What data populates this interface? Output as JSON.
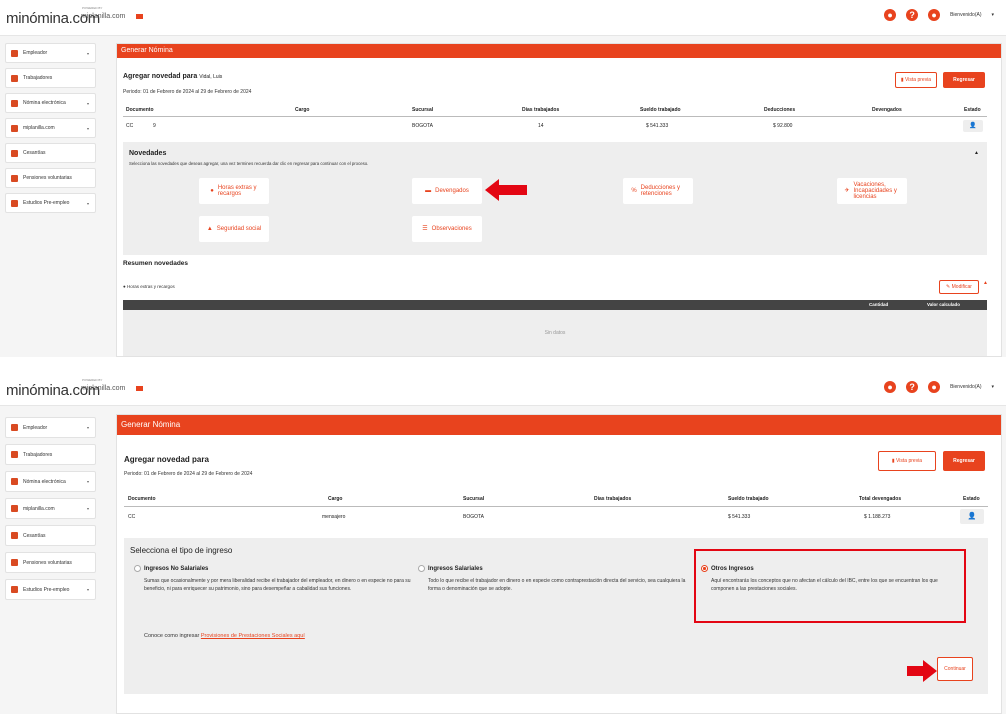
{
  "colors": {
    "brand": "#e8431e",
    "arrow": "#e30613",
    "highlight_box": "#e30613"
  },
  "shot1": {
    "header": {
      "logo": "minómina.com",
      "powered_by": "POWERED BY",
      "sublogo": "miplanilla.com",
      "welcome": "Bienvenido(A)"
    },
    "sidebar": {
      "items": [
        {
          "label": "Empleador",
          "caret": "▾",
          "icon": "building-icon"
        },
        {
          "label": "Trabajadores",
          "caret": "",
          "icon": "users-icon"
        },
        {
          "label": "Nómina electrónica",
          "caret": "▾",
          "icon": "document-icon"
        },
        {
          "label": "miplanilla.com",
          "caret": "▾",
          "icon": "document-icon"
        },
        {
          "label": "Cesantías",
          "caret": "",
          "icon": "piggy-bank-icon"
        },
        {
          "label": "Pensiones voluntarias",
          "caret": "",
          "icon": "hourglass-icon"
        },
        {
          "label": "Estudios Pre-empleo",
          "caret": "▾",
          "icon": "user-dollar-icon"
        }
      ]
    },
    "main": {
      "title": "Generar Nómina",
      "subtitle": "Agregar novedad para",
      "employee": "Vidal, Luis",
      "period": "Periodo: 01 de Febrero de 2024 al 29 de Febrero de 2024",
      "btn_preview": "Vista previa",
      "btn_back": "Regresar",
      "table": {
        "headers": [
          "Documento",
          "Cargo",
          "Sucursal",
          "Días trabajados",
          "Sueldo trabajado",
          "Deducciones",
          "Devengados",
          "Estado"
        ],
        "row": [
          "CC",
          "9",
          "BOGOTA",
          "14",
          "$ 541.333",
          "$ 92.800",
          "",
          ""
        ]
      },
      "novedades": {
        "title": "Novedades",
        "description": "Selecciona las novedades que deseas agregar, una vez termines recuerda dar clic en regresar para continuar con el proceso.",
        "collapse": "▲",
        "tiles": [
          {
            "label": "Horas extras y recargos",
            "icon": "clock-icon"
          },
          {
            "label": "Devengados",
            "icon": "money-icon"
          },
          {
            "label": "Deducciones y retenciones",
            "icon": "percent-icon"
          },
          {
            "label": "Vacaciones, Incapacidades y licencias",
            "icon": "plane-icon"
          },
          {
            "label": "Seguridad social",
            "icon": "hands-icon"
          },
          {
            "label": "Observaciones",
            "icon": "notes-icon"
          }
        ]
      },
      "resumen": {
        "title": "Resumen novedades",
        "item": "Horas extras y recargos",
        "btn_modify": "Modificar",
        "collapse": "▲",
        "headers": [
          "Cantidad",
          "Valor calculado"
        ],
        "empty": "Sin datos"
      }
    }
  },
  "shot2": {
    "header": {
      "logo": "minómina.com",
      "powered_by": "POWERED BY",
      "sublogo": "miplanilla.com",
      "welcome": "Bienvenido(A)"
    },
    "sidebar": {
      "items": [
        {
          "label": "Empleador",
          "caret": "▾",
          "icon": "building-icon"
        },
        {
          "label": "Trabajadores",
          "caret": "",
          "icon": "users-icon"
        },
        {
          "label": "Nómina electrónica",
          "caret": "▾",
          "icon": "document-icon"
        },
        {
          "label": "miplanilla.com",
          "caret": "▾",
          "icon": "document-icon"
        },
        {
          "label": "Cesantías",
          "caret": "",
          "icon": "piggy-bank-icon"
        },
        {
          "label": "Pensiones voluntarias",
          "caret": "",
          "icon": "hourglass-icon"
        },
        {
          "label": "Estudios Pre-empleo",
          "caret": "▾",
          "icon": "user-dollar-icon"
        }
      ]
    },
    "main": {
      "title": "Generar Nómina",
      "subtitle": "Agregar novedad para",
      "period": "Periodo: 01 de Febrero de 2024 al 29 de Febrero de 2024",
      "btn_preview": "Vista previa",
      "btn_back": "Regresar",
      "table": {
        "headers": [
          "Documento",
          "Cargo",
          "Sucursal",
          "Días trabajados",
          "Sueldo trabajado",
          "Total devengados",
          "Estado"
        ],
        "row": [
          "CC",
          "mensajero",
          "BOGOTA",
          "",
          "$ 541.333",
          "$ 1.188.273",
          ""
        ]
      },
      "tipo": {
        "title": "Selecciona el tipo de ingreso",
        "options": [
          {
            "label": "Ingresos No Salariales",
            "desc": "Sumas que ocasionalmente y por mera liberalidad recibe el trabajador del empleador, en dinero o en especie no para su beneficio, ni para enriquecer su patrimonio, sino para desempeñar a cabalidad sus funciones."
          },
          {
            "label": "Ingresos Salariales",
            "desc": "Todo lo que recibe el trabajador en dinero o en especie como contraprestación directa del servicio, sea cualquiera la forma o denominación que se adopte."
          },
          {
            "label": "Otros Ingresos",
            "desc": "Aquí encontrarás los conceptos que no afectan el cálculo del IBC, entre los que se encuentran los que componen a las prestaciones sociales."
          }
        ],
        "conoce": "Conoce como ingresar",
        "conoce_link": "Provisiones de Prestaciones Sociales aquí",
        "btn_continue": "Continuar"
      }
    }
  }
}
